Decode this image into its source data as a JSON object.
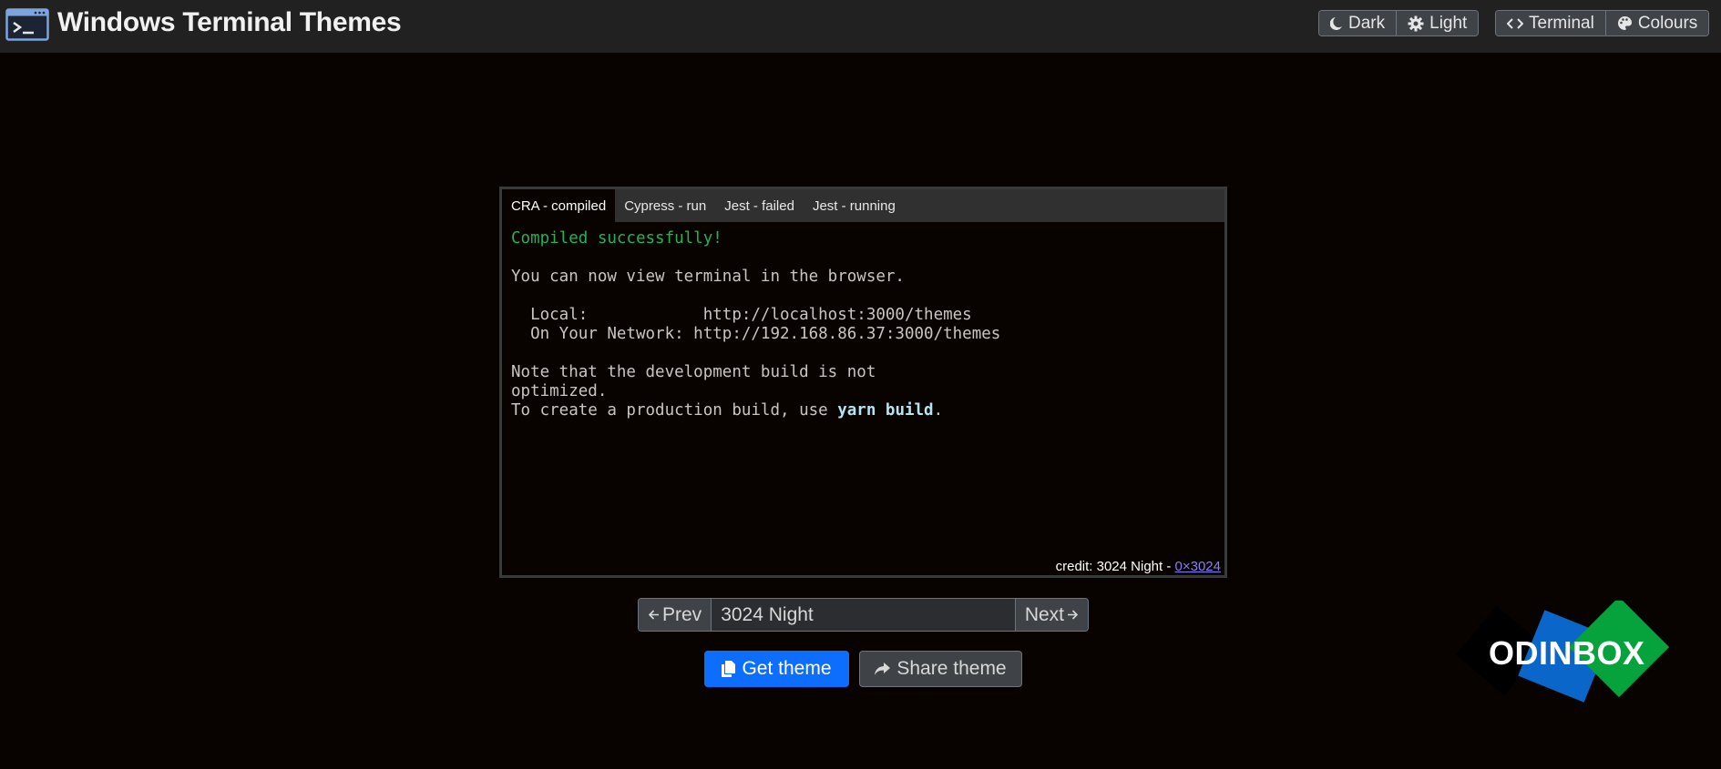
{
  "header": {
    "title": "Windows Terminal Themes",
    "mode_buttons": [
      {
        "label": "Dark",
        "icon": "moon-icon"
      },
      {
        "label": "Light",
        "icon": "gear-icon"
      }
    ],
    "view_buttons": [
      {
        "label": "Terminal",
        "icon": "code-icon"
      },
      {
        "label": "Colours",
        "icon": "palette-icon"
      }
    ]
  },
  "terminal": {
    "tabs": [
      "CRA - compiled",
      "Cypress - run",
      "Jest - failed",
      "Jest - running"
    ],
    "active_tab": "CRA - compiled",
    "lines": {
      "compiled": "Compiled successfully!",
      "view": "You can now view terminal in the browser.",
      "local": "  Local:            http://localhost:3000/themes",
      "network": "  On Your Network: http://192.168.86.37:3000/themes",
      "note1": "Note that the development build is not",
      "note2": "optimized.",
      "create_prefix": "To create a production build, use ",
      "create_cmd": "yarn build",
      "create_suffix": "."
    },
    "credit_prefix": "credit: 3024 Night - ",
    "credit_link": "0×3024"
  },
  "picker": {
    "prev_label": "Prev",
    "theme_name": "3024 Night",
    "next_label": "Next"
  },
  "actions": {
    "get_theme": "Get theme",
    "share_theme": "Share theme"
  },
  "watermark": {
    "text": "ODINBOX"
  },
  "colors": {
    "background": "#090300",
    "navbar": "#212121",
    "primary": "#0d6efd",
    "green_text": "#23b351",
    "cyan_text": "#b5e4f4",
    "credit_link": "#8b7cff",
    "watermark_blue": "#0a66c8",
    "watermark_green": "#06a33c"
  }
}
